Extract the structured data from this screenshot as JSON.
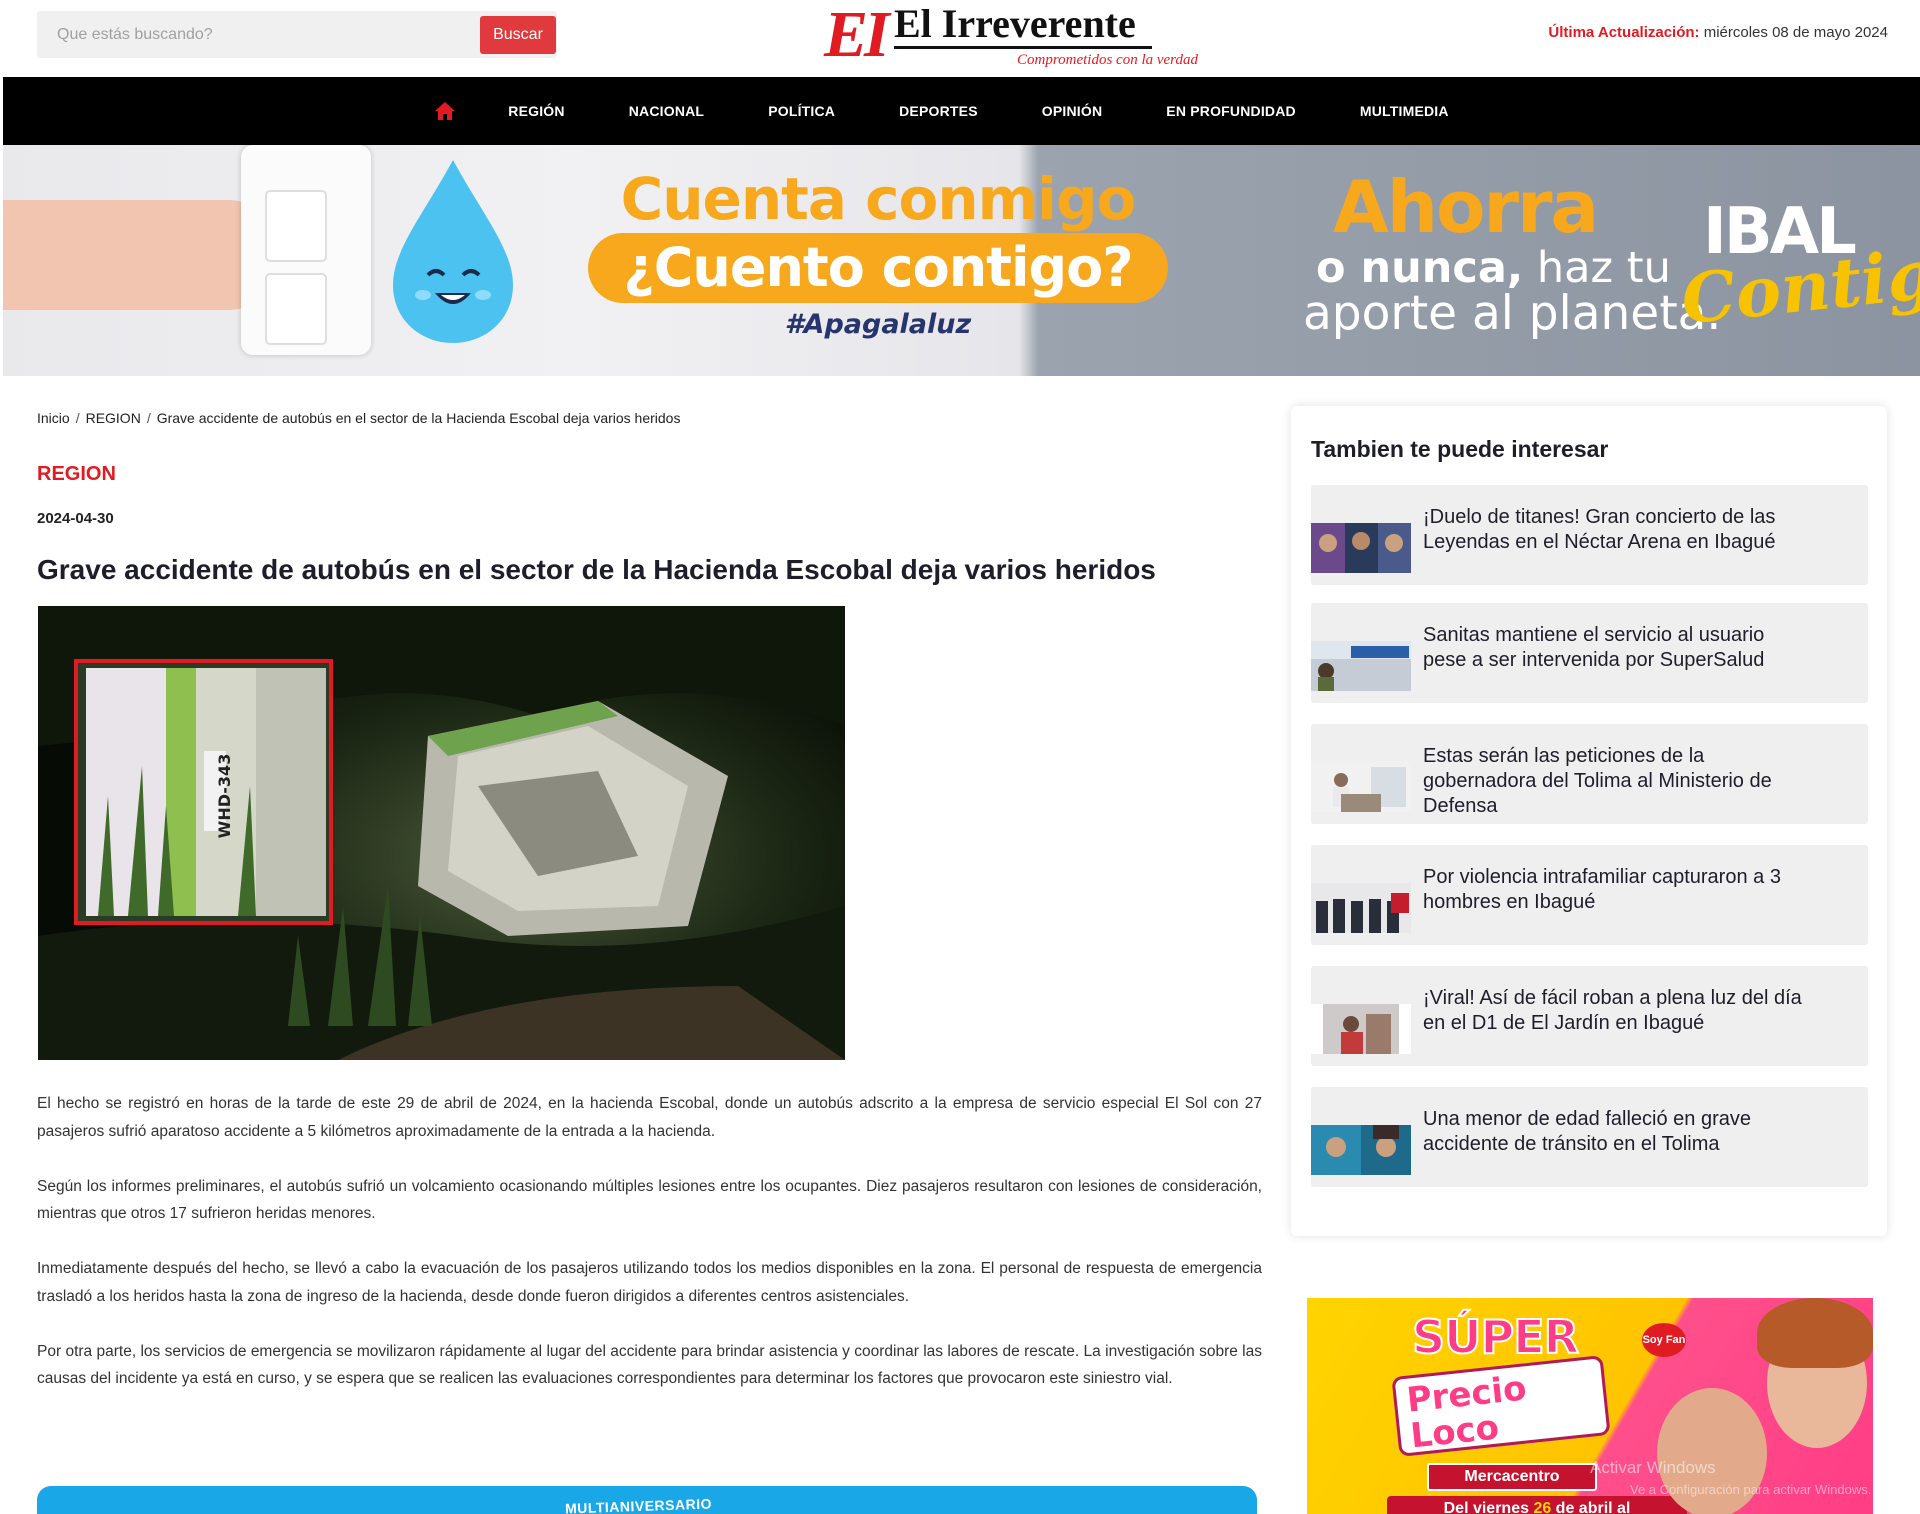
{
  "header": {
    "search_placeholder": "Que estás buscando?",
    "search_button": "Buscar",
    "logo": {
      "mark": "EI",
      "name": "El Irreverente",
      "tagline": "Comprometidos con la verdad"
    },
    "update_label": "Última Actualización:",
    "update_value": "miércoles 08 de mayo 2024"
  },
  "nav": {
    "home_icon": "home-icon",
    "items": [
      "REGIÓN",
      "NACIONAL",
      "POLÍTICA",
      "DEPORTES",
      "OPINIÓN",
      "EN PROFUNDIDAD",
      "MULTIMEDIA"
    ]
  },
  "banner": {
    "line1": "Cuenta conmigo",
    "line2": "¿Cuento contigo?",
    "hashtag": "#Apagalaluz",
    "right1": "Ahorra",
    "right2_bold": "o nunca,",
    "right2_rest": " haz tu",
    "right3": "aporte al planeta.",
    "brand": "IBAL",
    "brand_script": "Contigo"
  },
  "article": {
    "breadcrumb": [
      "Inicio",
      "REGION",
      "Grave accidente de autobús en el sector de la Hacienda Escobal deja varios heridos"
    ],
    "section": "REGION",
    "date": "2024-04-30",
    "title": "Grave accidente de autobús en el sector de la Hacienda Escobal deja varios heridos",
    "photo_plate": "WHD-343",
    "paragraphs": [
      "El hecho se registró en horas de la tarde de este 29 de abril de 2024, en la hacienda Escobal, donde un autobús adscrito a la empresa de servicio especial El Sol con 27 pasajeros sufrió aparatoso accidente a 5 kilómetros aproximadamente de la entrada a la hacienda.",
      "Según los informes preliminares, el autobús sufrió un volcamiento ocasionando múltiples lesiones entre los ocupantes. Diez pasajeros resultaron con lesiones de consideración, mientras que otros 17 sufrieron heridas menores.",
      "Inmediatamente después del hecho, se llevó a cabo la evacuación de los pasajeros utilizando todos los medios disponibles en la zona. El personal de respuesta de emergencia trasladó a los heridos hasta la zona de ingreso de la hacienda, desde donde fueron dirigidos a diferentes centros asistenciales.",
      "Por otra parte, los servicios de emergencia se movilizaron rápidamente al lugar del accidente para brindar asistencia y coordinar las labores de rescate. La investigación sobre las causas del incidente ya está en curso, y se espera que se realicen las evaluaciones correspondientes para determinar los factores que provocaron este siniestro vial."
    ],
    "bottom_promo": "MULTIANIVERSARIO"
  },
  "sidebar": {
    "title": "Tambien te puede interesar",
    "items": [
      {
        "title": "¡Duelo de titanes! Gran concierto de las Leyendas en el Néctar Arena en Ibagué"
      },
      {
        "title": "Sanitas mantiene el servicio al usuario pese a ser intervenida por SuperSalud"
      },
      {
        "title": "Estas serán las peticiones de la gobernadora del Tolima al Ministerio de Defensa"
      },
      {
        "title": "Por violencia intrafamiliar capturaron a 3 hombres en Ibagué"
      },
      {
        "title": "¡Viral! Así de fácil roban a plena luz del día en el D1 de El Jardín en Ibagué"
      },
      {
        "title": "Una menor de edad falleció en grave accidente de tránsito en el Tolima"
      }
    ]
  },
  "side_ad": {
    "super": "SÚPER",
    "precio": "Precio Loco",
    "store": "Mercacentro",
    "date_prefix": "Del viernes ",
    "date_num": "26",
    "date_suffix": " de abril al",
    "badge": "Soy Fan"
  },
  "os_watermark": {
    "line1": "Activar Windows",
    "line2": "Ve a Configuración para activar Windows."
  },
  "colors": {
    "brand_red": "#e11b22",
    "button_red": "#e03a3e",
    "nav_bg": "#000000",
    "banner_orange": "#f7a81d"
  }
}
